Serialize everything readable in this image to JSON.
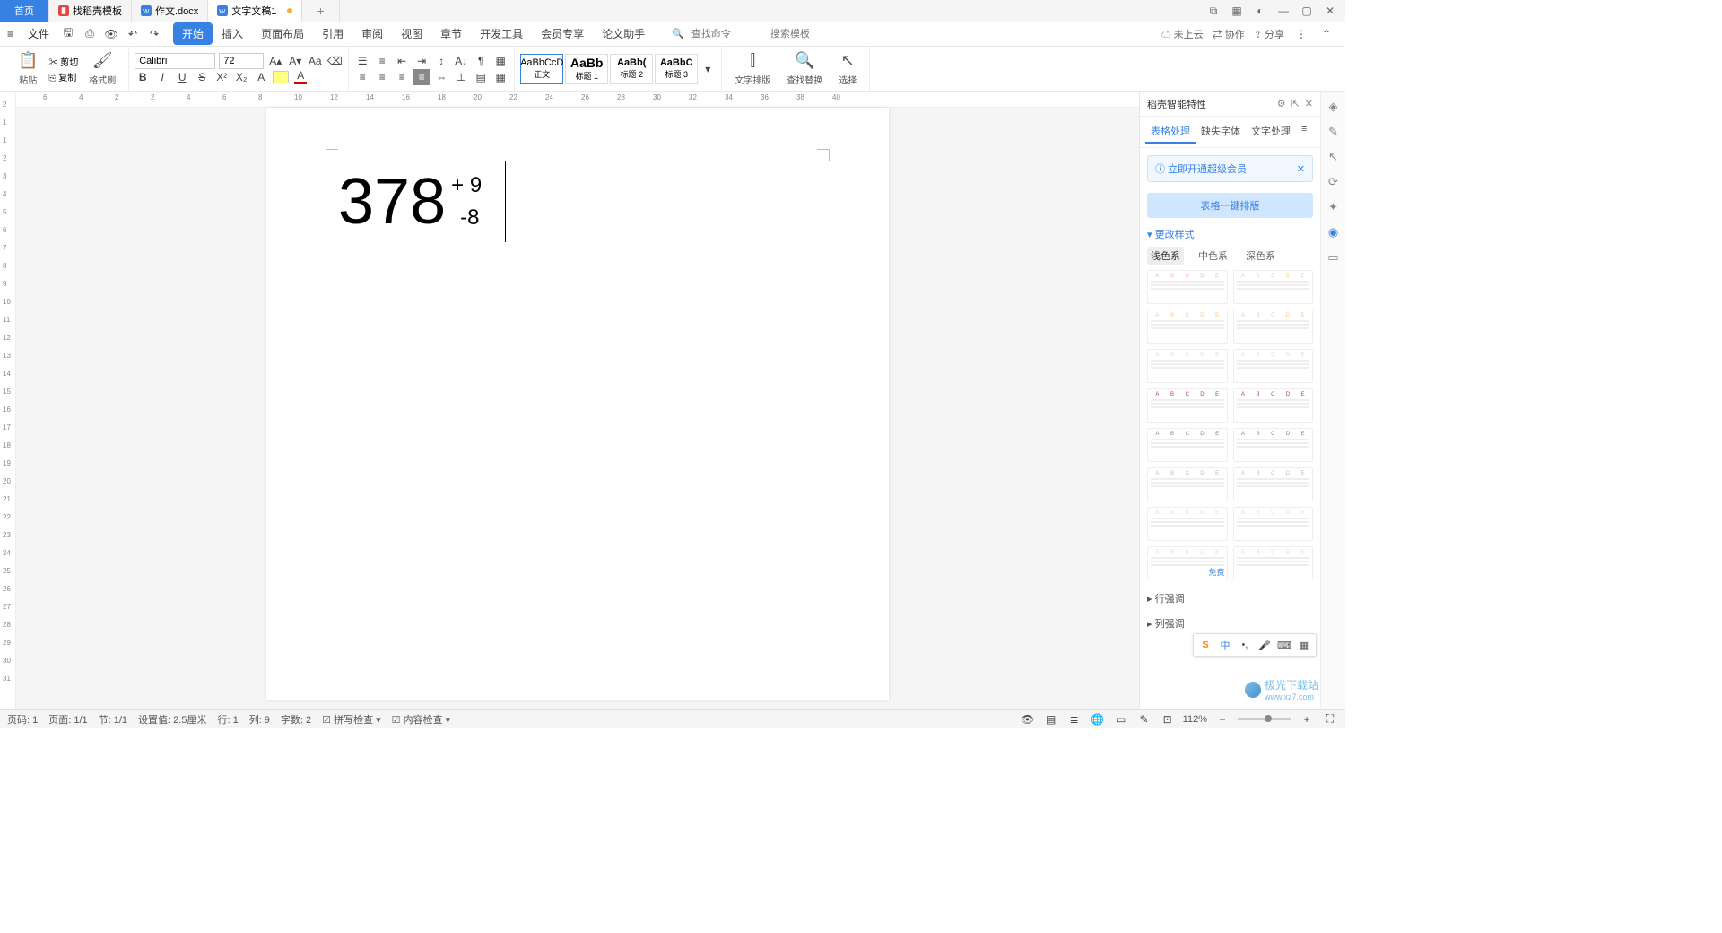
{
  "titlebar": {
    "home": "首页",
    "tabs": [
      {
        "label": "找稻壳模板"
      },
      {
        "label": "作文.docx"
      },
      {
        "label": "文字文稿1"
      }
    ]
  },
  "menubar": {
    "file": "文件",
    "tabs": [
      "开始",
      "插入",
      "页面布局",
      "引用",
      "审阅",
      "视图",
      "章节",
      "开发工具",
      "会员专享",
      "论文助手"
    ],
    "search_cmd_placeholder": "查找命令",
    "search_tpl_placeholder": "搜索模板",
    "right": {
      "cloud": "未上云",
      "collab": "协作",
      "share": "分享"
    }
  },
  "ribbon": {
    "paste": "粘贴",
    "cut": "剪切",
    "copy": "复制",
    "format_painter": "格式刷",
    "font_name": "Calibri",
    "font_size": "72",
    "styles": [
      {
        "sample": "AaBbCcD",
        "name": "正文"
      },
      {
        "sample": "AaBb",
        "name": "标题 1"
      },
      {
        "sample": "AaBb(",
        "name": "标题 2"
      },
      {
        "sample": "AaBbC",
        "name": "标题 3"
      }
    ],
    "text_layout": "文字排版",
    "find_replace": "查找替换",
    "select": "选择"
  },
  "ruler": {
    "top": [
      "6",
      "4",
      "2",
      "2",
      "4",
      "6",
      "8",
      "10",
      "12",
      "14",
      "16",
      "18",
      "20",
      "22",
      "24",
      "26",
      "28",
      "30",
      "32",
      "34",
      "36",
      "38",
      "40"
    ],
    "left": [
      "2",
      "1",
      "1",
      "2",
      "3",
      "4",
      "5",
      "6",
      "7",
      "8",
      "9",
      "10",
      "11",
      "12",
      "13",
      "14",
      "15",
      "16",
      "17",
      "18",
      "19",
      "20",
      "21",
      "22",
      "23",
      "24",
      "25",
      "26",
      "27",
      "28",
      "29",
      "30",
      "31"
    ]
  },
  "document": {
    "main": "378",
    "sup": "+ 9",
    "sub": "-8"
  },
  "right_panel": {
    "title": "稻壳智能特性",
    "tabs": [
      "表格处理",
      "缺失字体",
      "文字处理"
    ],
    "notice": "立即开通超级会员",
    "action": "表格一键排版",
    "section_style": "更改样式",
    "color_tabs": [
      "浅色系",
      "中色系",
      "深色系"
    ],
    "free_tag": "免费",
    "collapse": [
      "行强调",
      "列强调"
    ]
  },
  "statusbar": {
    "page_label": "页码: 1",
    "page_of": "页面: 1/1",
    "section": "节: 1/1",
    "pos": "设置值: 2.5厘米",
    "line": "行: 1",
    "col": "列: 9",
    "words": "字数: 2",
    "spell": "拼写检查",
    "content_check": "内容检查",
    "zoom": "112%"
  },
  "ime": {
    "cn": "中"
  },
  "watermark": {
    "text1": "极光下载站",
    "text2": "www.xz7.com"
  },
  "thumb_letters": [
    "A",
    "B",
    "C",
    "D",
    "E"
  ],
  "thumb_colors": [
    "#f3b0b0",
    "#f5c89a",
    "#f5c89a",
    "#f5c89a",
    "#c8e8c8",
    "#c8e8c8",
    "#c04040",
    "#c04040",
    "#888",
    "#888",
    "#bbb",
    "#bbb",
    "#ddd",
    "#ddd",
    "#ddd",
    "#ddd",
    "#f0c0c0",
    "#c0d8f0",
    "#b0d8c8",
    "#c0d8f0"
  ]
}
